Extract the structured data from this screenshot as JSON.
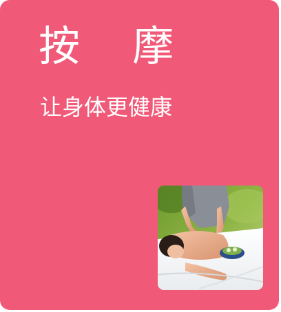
{
  "tile": {
    "title": "按    摩",
    "subtitle": "让身体更健康",
    "background_color": "#f05a78",
    "text_color": "#ffffff"
  },
  "photo": {
    "icon": "massage-photo"
  }
}
